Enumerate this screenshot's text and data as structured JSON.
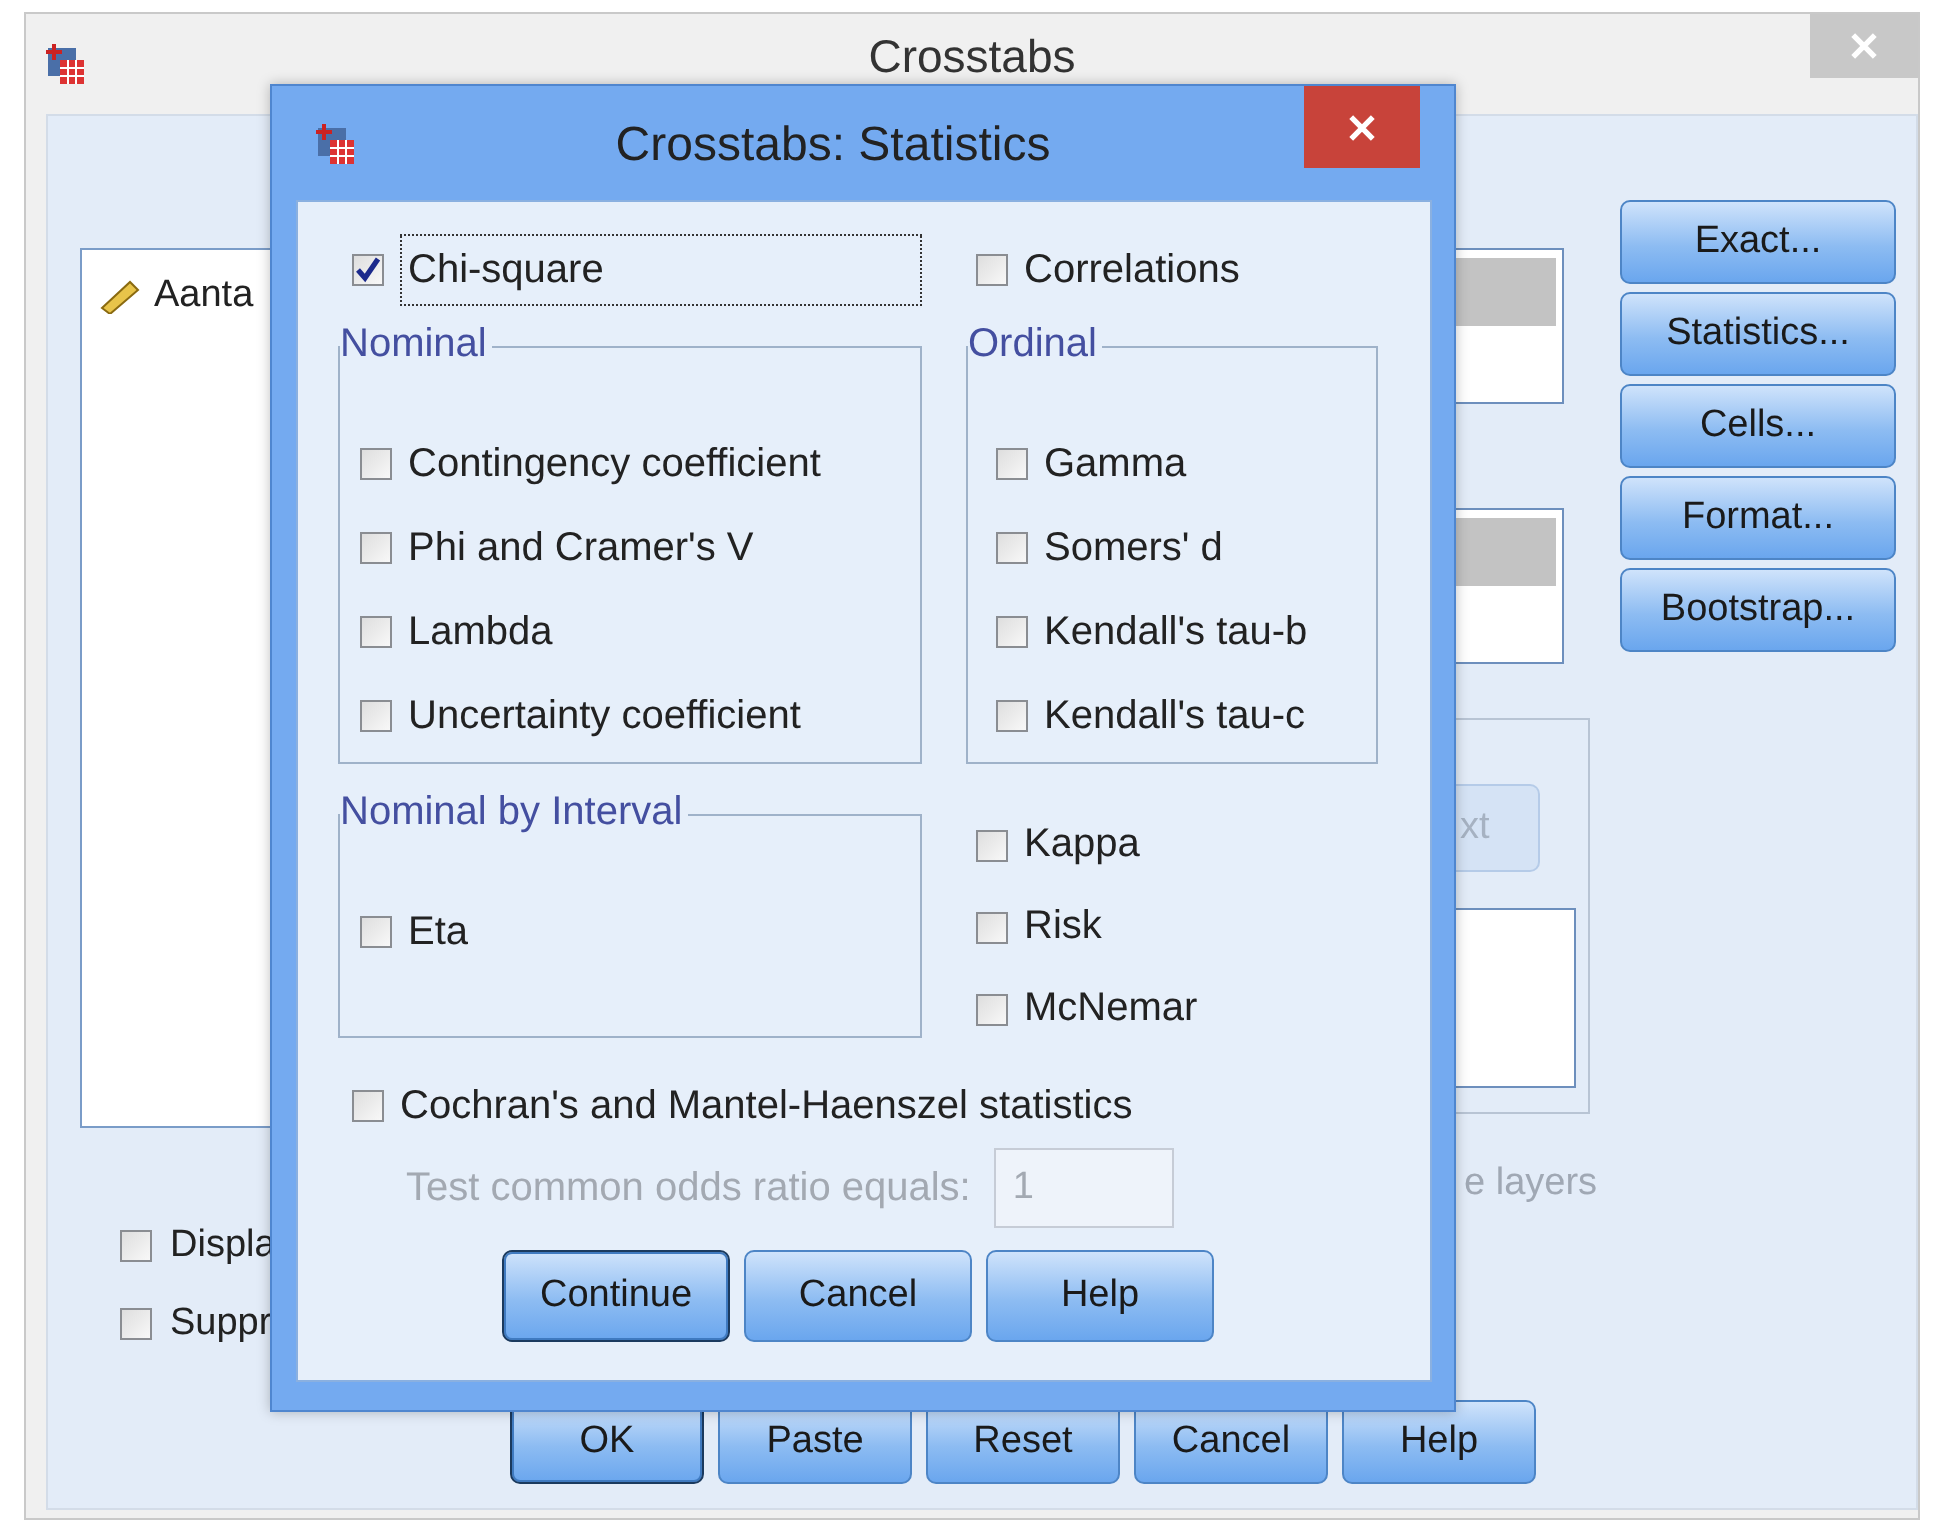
{
  "main_window": {
    "title": "Crosstabs",
    "variable_list": [
      {
        "label": "Aanta"
      }
    ],
    "side_buttons": [
      "Exact...",
      "Statistics...",
      "Cells...",
      "Format...",
      "Bootstrap..."
    ],
    "next_button": {
      "label": "xt",
      "disabled": true
    },
    "layers_text": "e layers",
    "options": [
      {
        "label": "Displa",
        "checked": false
      },
      {
        "label": "Suppr",
        "checked": false
      }
    ],
    "buttons": [
      {
        "label": "OK",
        "default": true
      },
      {
        "label": "Paste",
        "default": false
      },
      {
        "label": "Reset",
        "default": false
      },
      {
        "label": "Cancel",
        "default": false
      },
      {
        "label": "Help",
        "default": false
      }
    ]
  },
  "dialog": {
    "title": "Crosstabs: Statistics",
    "chi_square": {
      "label": "Chi-square",
      "checked": true
    },
    "correlations": {
      "label": "Correlations",
      "checked": false
    },
    "groups": [
      {
        "title": "Nominal",
        "items": [
          {
            "label": "Contingency coefficient",
            "checked": false
          },
          {
            "label": "Phi and Cramer's V",
            "checked": false
          },
          {
            "label": "Lambda",
            "checked": false
          },
          {
            "label": "Uncertainty coefficient",
            "checked": false
          }
        ]
      },
      {
        "title": "Ordinal",
        "items": [
          {
            "label": "Gamma",
            "checked": false
          },
          {
            "label": "Somers' d",
            "checked": false
          },
          {
            "label": "Kendall's tau-b",
            "checked": false
          },
          {
            "label": "Kendall's tau-c",
            "checked": false
          }
        ]
      },
      {
        "title": "Nominal by Interval",
        "items": [
          {
            "label": "Eta",
            "checked": false
          }
        ]
      }
    ],
    "other": [
      {
        "label": "Kappa",
        "checked": false
      },
      {
        "label": "Risk",
        "checked": false
      },
      {
        "label": "McNemar",
        "checked": false
      }
    ],
    "cochran": {
      "label": "Cochran's and Mantel-Haenszel statistics",
      "checked": false
    },
    "odds_ratio": {
      "label": "Test common odds ratio equals:",
      "value": "1",
      "disabled": true
    },
    "buttons": [
      {
        "label": "Continue",
        "default": true
      },
      {
        "label": "Cancel",
        "default": false
      },
      {
        "label": "Help",
        "default": false
      }
    ]
  }
}
